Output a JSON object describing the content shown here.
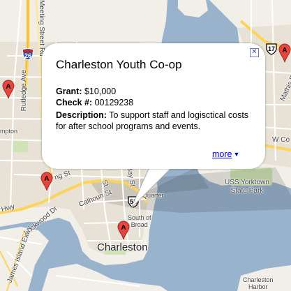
{
  "map": {
    "colors": {
      "water": "#99b3cc",
      "land": "#f2efe9",
      "urban": "#e6e0d3",
      "park": "#cfe3b4",
      "highway": "#fdd35a",
      "road": "#ffffff",
      "pin": "#e8453c"
    },
    "labels": {
      "meeting_street_rd": "Meeting Street Rd",
      "rutledge_ave": "Rutledge Ave",
      "hampton": "mpton",
      "hwy": "Hwy",
      "lockwood_dr": "Lockwood Dr",
      "james_island_exwy": "James Island Exwy",
      "king_st": "ng St",
      "calhoun_st": "Calhoun St",
      "bay_st": "Bay St",
      "st_fragment": "St",
      "quarter": "Quarter",
      "south_of_broad_line1": "South of",
      "south_of_broad_line2": "Broad",
      "charleston": "Charleston",
      "uss_yorktown_line1": "USS Yorktown",
      "uss_yorktown_line2": "State Park",
      "mathis_fragment": "Mathis F",
      "w_co_fragment": "W Co",
      "charleston_harbor_line1": "Charleston",
      "charleston_harbor_line2": "Harbor"
    },
    "shields": {
      "i26": "26",
      "us52": "52",
      "us17": "17"
    },
    "pins": [
      {
        "id": "pin-north",
        "letter": "A"
      },
      {
        "id": "pin-west",
        "letter": "A"
      },
      {
        "id": "pin-northeast",
        "letter": "A"
      },
      {
        "id": "pin-center",
        "letter": "A"
      },
      {
        "id": "pin-south",
        "letter": "A"
      }
    ]
  },
  "info_window": {
    "title": "Charleston Youth Co-op",
    "grant_label": "Grant:",
    "grant_value": "$10,000",
    "check_label": "Check #:",
    "check_value": "00129238",
    "description_label": "Description:",
    "description_value": "To support staff and logisctical costs for after school programs and events.",
    "more_link": "more",
    "more_arrow": "▼",
    "close_symbol": "✕"
  }
}
